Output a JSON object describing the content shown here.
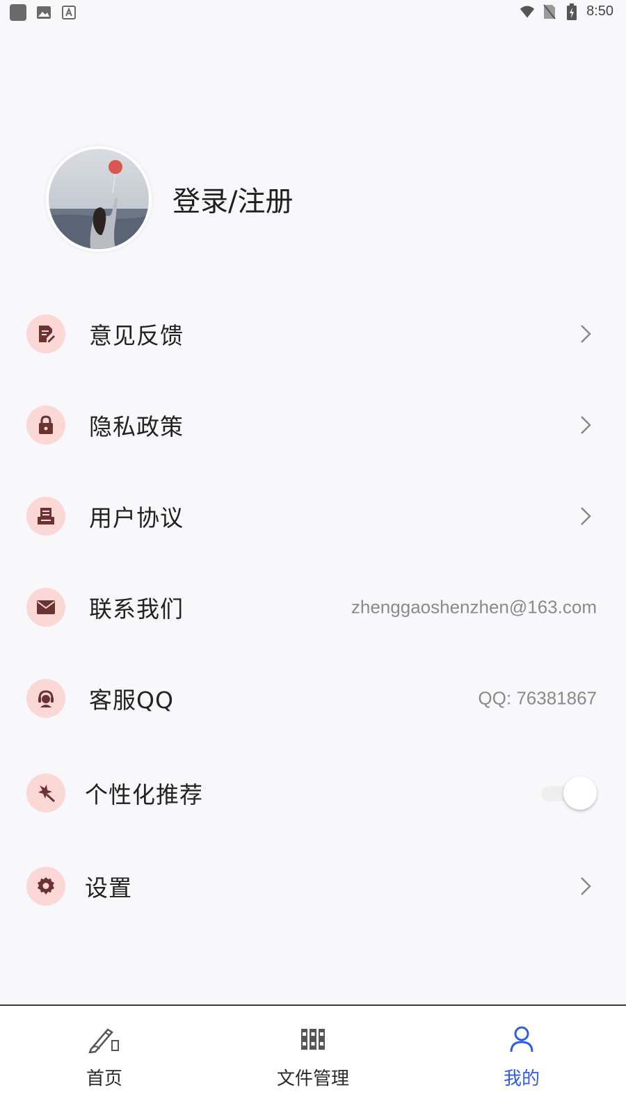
{
  "status_bar": {
    "time": "8:50",
    "left_icons": [
      "app-square-icon",
      "image-icon",
      "font-icon"
    ],
    "right_icons": [
      "wifi-icon",
      "no-sim-icon",
      "battery-charging-icon"
    ]
  },
  "profile": {
    "login_label": "登录/注册",
    "avatar_icon": "avatar-photo"
  },
  "menu": {
    "feedback": {
      "label": "意见反馈",
      "icon": "edit-document-icon"
    },
    "privacy": {
      "label": "隐私政策",
      "icon": "lock-icon"
    },
    "agreement": {
      "label": "用户协议",
      "icon": "document-tray-icon"
    },
    "contact": {
      "label": "联系我们",
      "icon": "mail-icon",
      "value": "zhenggaoshenzhen@163.com"
    },
    "qq": {
      "label": "客服QQ",
      "icon": "customer-service-icon",
      "value": "QQ: 76381867"
    },
    "personalize": {
      "label": "个性化推荐",
      "icon": "sparkle-icon",
      "enabled": false
    },
    "settings": {
      "label": "设置",
      "icon": "gear-icon"
    }
  },
  "bottom_nav": {
    "home": {
      "label": "首页",
      "icon": "pen-icon"
    },
    "files": {
      "label": "文件管理",
      "icon": "binders-icon"
    },
    "mine": {
      "label": "我的",
      "icon": "user-icon",
      "active": true
    }
  },
  "colors": {
    "accent": "#2f5bea",
    "icon_bg": "#fbd7d6",
    "icon_fg": "#6b3232",
    "background": "#f8f8fa"
  }
}
